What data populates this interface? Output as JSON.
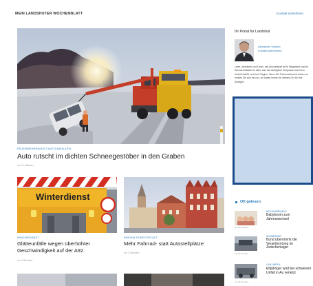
{
  "header": {
    "title": "MEIN LANDSHUTER WOCHENBLATT",
    "right_link": "Kontakt aufnehmen"
  },
  "main_article": {
    "category": "FEUERWEHREINSATZ AUTOUNFALLEN",
    "headline": "Auto rutscht im dichten Schneegestöber in den Graben",
    "time": "vor 11 Minuten"
  },
  "card_left": {
    "image_sign": "Winterdienst",
    "category": "WINTERDIENST",
    "headline": "Glätteunfälle wegen überhöhter Geschwindigkeit auf der A92",
    "time": "vor 2 Stunden"
  },
  "card_right": {
    "category": "DREIFALTIGKEITSPLATZ",
    "headline": "Mehr Fahrrad- statt Autostellplätze",
    "time": "vor 2 Stunden"
  },
  "sidebar": {
    "title": "Ihr Portal für Landshut",
    "author_name": "Alexander Schmid",
    "author_link": "Kontakt aufnehmen",
    "intro": "Liebe Leserinnen und Leser, das Wochenblatt ist Ihr Wegweiser und Ihr Wochenindikator für alles, was die wichtigsten Ereignisse aus Ihrem Umfeld betrifft, aus Ihrer Region. Wenn Sie Themenwünsche haben, so melden Sie sich bei uns, wir haben immer ein offenes Ohr für Ihre Anliegen!",
    "ad_fill": "#c6d9ec",
    "ad_border": "#1a4a8a",
    "oft_gelesen_title": "Oft gelesen",
    "items": [
      {
        "category": "NEUJAHRSBABYS",
        "title": "Babyboom zum Jahreswechsel",
        "time": "vor 16 Stunden"
      },
      {
        "category": "KOMMENTAR",
        "title": "Bund übernimmt die Verantwortung im Zwischenlager",
        "time": "vor 13 Stunden"
      },
      {
        "category": "LKW-UNFALL",
        "title": "Elfjähriger wird bei schwerem Unfall in Au verletzt",
        "time": "vor 19 Stunden"
      }
    ]
  },
  "colors": {
    "accent_blue": "#2a7ab8",
    "arrow_yellow": "#e7b318"
  }
}
